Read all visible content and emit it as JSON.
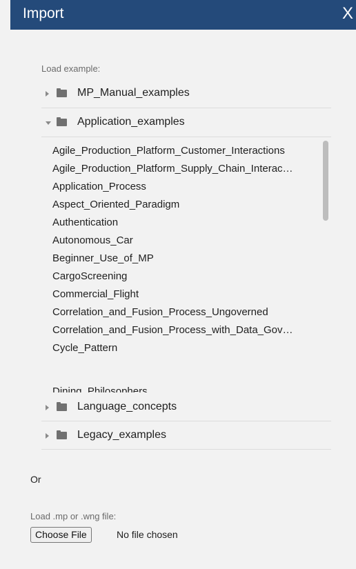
{
  "dialog": {
    "title": "Import",
    "close_glyph": "X"
  },
  "load_example_label": "Load example:",
  "folders_top": [
    {
      "name": "MP_Manual_examples",
      "expanded": false
    },
    {
      "name": "Application_examples",
      "expanded": true
    }
  ],
  "application_examples": [
    "Agile_Production_Platform_Customer_Interactions",
    "Agile_Production_Platform_Supply_Chain_Interac…",
    "Application_Process",
    "Aspect_Oriented_Paradigm",
    "Authentication",
    "Autonomous_Car",
    "Beginner_Use_of_MP",
    "CargoScreening",
    "Commercial_Flight",
    "Correlation_and_Fusion_Process_Ungoverned",
    "Correlation_and_Fusion_Process_with_Data_Gov…",
    "Cycle_Pattern",
    "Dining_Philosophers"
  ],
  "folders_bottom": [
    {
      "name": "Language_concepts",
      "expanded": false
    },
    {
      "name": "Legacy_examples",
      "expanded": false
    }
  ],
  "or_label": "Or",
  "file_load": {
    "label": "Load .mp or .wng file:",
    "button_label": "Choose File",
    "status": "No file chosen"
  },
  "colors": {
    "title_bar": "#244a7a",
    "background": "#f2f2f2"
  },
  "icons": {
    "close": "close-icon",
    "folder": "folder-icon",
    "expand": "chevron-right-icon",
    "collapse": "chevron-down-icon"
  }
}
